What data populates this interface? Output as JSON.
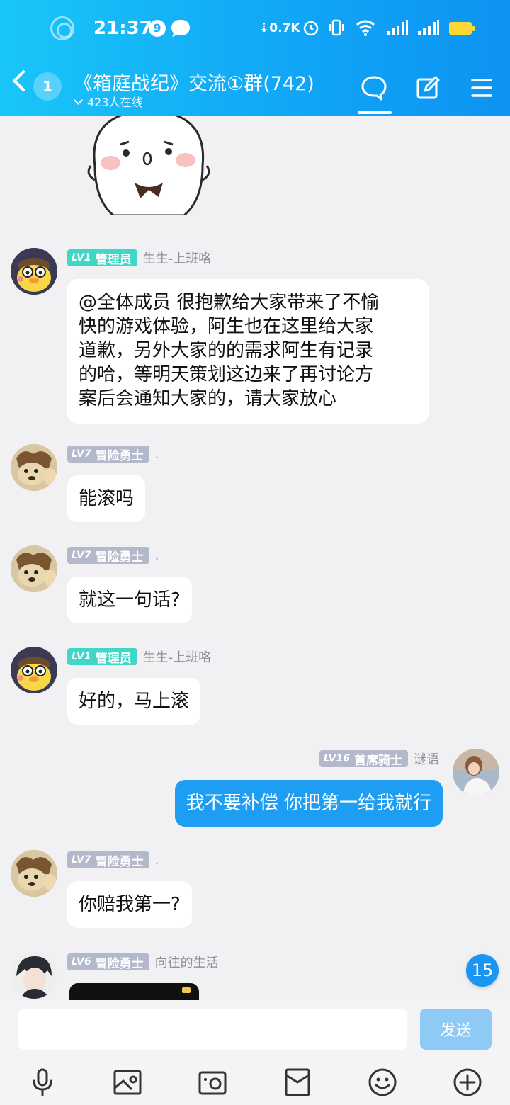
{
  "status_bar": {
    "time": "21:37",
    "notification_count": "9",
    "net_speed": "0.7K"
  },
  "header": {
    "back_count": "1",
    "title": "《箱庭战纪》交流①群(742)",
    "online": "423人在线"
  },
  "messages": [
    {
      "level": "LV1",
      "role": "管理员",
      "role_type": "admin",
      "nick": "生生-上班咯",
      "text_lines": [
        "@全体成员 很抱歉给大家带来了不愉",
        "快的游戏体验，阿生也在这里给大家",
        "道歉，另外大家的的需求阿生有记录",
        "的哈，等明天策划这边来了再讨论方",
        "案后会通知大家的，请大家放心"
      ],
      "self": false
    },
    {
      "level": "LV7",
      "role": "冒险勇士",
      "role_type": "member",
      "nick": ".",
      "text": "能滚吗",
      "self": false
    },
    {
      "level": "LV7",
      "role": "冒险勇士",
      "role_type": "member",
      "nick": ".",
      "text": "就这一句话?",
      "self": false
    },
    {
      "level": "LV1",
      "role": "管理员",
      "role_type": "admin",
      "nick": "生生-上班咯",
      "text": "好的，马上滚",
      "self": false
    },
    {
      "level": "LV16",
      "role": "首席骑士",
      "role_type": "member",
      "nick": "谜语",
      "text": "我不要补偿  你把第一给我就行",
      "self": true
    },
    {
      "level": "LV7",
      "role": "冒险勇士",
      "role_type": "member",
      "nick": ".",
      "text": "你赔我第一?",
      "self": false
    },
    {
      "level": "LV6",
      "role": "冒险勇士",
      "role_type": "member",
      "nick": "向往的生活",
      "text": "",
      "self": false
    }
  ],
  "unread_count": "15",
  "composer": {
    "placeholder": "",
    "send_label": "发送"
  },
  "toolbar": [
    "mic-icon",
    "image-icon",
    "camera-icon",
    "red-packet-icon",
    "emoji-icon",
    "plus-icon"
  ],
  "colors": {
    "header": "#11a7f6",
    "self_bubble": "#1e9ef3",
    "admin_badge": "#40d7c6",
    "member_badge": "#b3b8cb"
  }
}
